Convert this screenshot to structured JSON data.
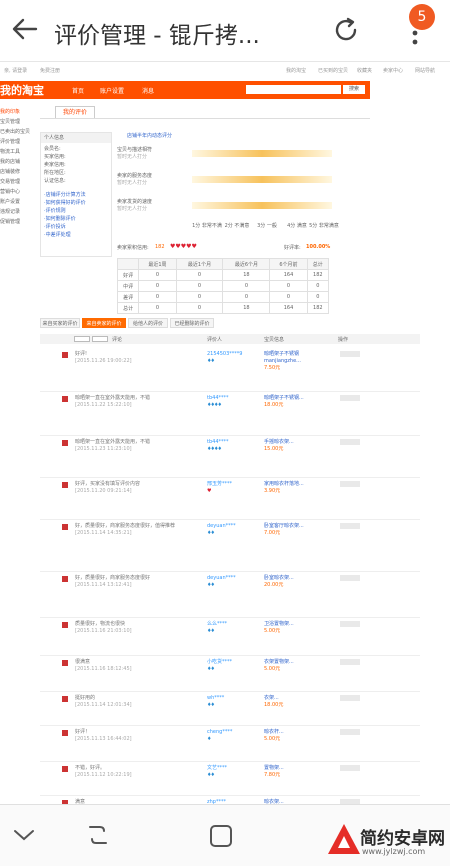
{
  "browser": {
    "title": "评价管理 - 锟斤拷...",
    "tab_count": "5"
  },
  "page": {
    "topstrip": [
      "亲, 请登录",
      "免费注册",
      "我的淘宝",
      "已买到的宝贝",
      "收藏夹",
      "卖家中心",
      "网站导航"
    ],
    "logo": "我的淘宝",
    "nav": [
      "首页",
      "账户设置",
      "消息"
    ],
    "search_button": "搜索",
    "left_menu": [
      "我的印象",
      "宝贝管理",
      "已卖出的宝贝",
      "评价管理",
      "物流工具",
      "我的店铺",
      "店铺装修",
      "交易管理",
      "营销中心",
      "账户设置",
      "违规记录",
      "促销管理"
    ],
    "tab_label": "我的评价",
    "panel": {
      "header": "个人信息",
      "lines": [
        "会员名: ",
        "买家信用:",
        "卖家信用:",
        "所在地区:",
        "认证信息:"
      ],
      "links": [
        "·店铺评分计算方法",
        "·如何获得好的评价",
        "·评价规则",
        "·如何删除评价",
        "·评价投诉",
        "·中差评处理"
      ]
    },
    "rating_title": "店铺半年内动态评分",
    "rating_rows": [
      {
        "label": "宝贝与描述相符",
        "sub": "暂时无人打分"
      },
      {
        "label": "卖家的服务态度",
        "sub": "暂时无人打分"
      },
      {
        "label": "卖家发货的速度",
        "sub": "暂时无人打分"
      }
    ],
    "scale": [
      "1分\n非常不满",
      "2分\n不满意",
      "3分\n一般",
      "4分\n满意",
      "5分\n非常满意"
    ],
    "credit_label": "卖家累积信用:",
    "credit_value": "182",
    "positive_label": "好评率:",
    "positive_value": "100.00%",
    "table": {
      "headers": [
        "",
        "最近1周",
        "最近1个月",
        "最近6个月",
        "6个月前",
        "总计"
      ],
      "rows": [
        [
          "好评",
          "0",
          "0",
          "18",
          "164",
          "182"
        ],
        [
          "中评",
          "0",
          "0",
          "0",
          "0",
          "0"
        ],
        [
          "差评",
          "0",
          "0",
          "0",
          "0",
          "0"
        ],
        [
          "总计",
          "0",
          "0",
          "18",
          "164",
          "182"
        ]
      ]
    },
    "tabs": [
      "来自买家的评价",
      "来自卖家的评价",
      "给他人的评价",
      "已经删除的评价"
    ],
    "filter": [
      "评论",
      "评价人",
      "宝贝信息",
      "操作"
    ]
  },
  "reviews": [
    {
      "text": "好评!",
      "time": "[2015.11.26 19:00:22]",
      "buyer": "2154503****9",
      "stars": "♦♦",
      "item": "晾晒架子不锈钢manjiangzhe...",
      "price": "7.50元"
    },
    {
      "text": "晾晒架一直在室外露天能用，不错",
      "time": "[2015.11.22 15:22:10]",
      "buyer": "tb44****",
      "stars": "♦♦♦♦",
      "item": "晾晒架子不锈钢...",
      "price": "18.00元"
    },
    {
      "text": "晾晒架一直在室外露天能用，不错",
      "time": "[2015.11.23 11:23:10]",
      "buyer": "tb44****",
      "stars": "♦♦♦♦",
      "item": "手摇晾衣架...",
      "price": "15.00元"
    },
    {
      "text": "好评，买家没有填写评价内容",
      "time": "[2015.11.20 09:21:14]",
      "buyer": "邢玉芳****",
      "stars": "♥",
      "item": "家用晾衣杆落地...",
      "price": "3.90元"
    },
    {
      "text": "好，质量很好，商家服务态度很好，值得推荐",
      "time": "[2015.11.14 14:35:21]",
      "buyer": "deyuan****",
      "stars": "♦♦",
      "item": "卧室客厅晾衣架...",
      "price": "7.00元"
    },
    {
      "text": "好，质量很好，商家服务态度很好",
      "time": "[2015.11.14 13:12:41]",
      "buyer": "deyuan****",
      "stars": "♦♦",
      "item": "卧室晾衣架...",
      "price": "20.00元"
    },
    {
      "text": "质量很好，物流也很快",
      "time": "[2015.11.16 21:03:10]",
      "buyer": "么么****",
      "stars": "♦♦",
      "item": "卫浴置物架...",
      "price": "5.00元"
    },
    {
      "text": "很满意",
      "time": "[2015.11.16 18:12:45]",
      "buyer": "小吃货****",
      "stars": "♦♦",
      "item": "衣架置物架...",
      "price": "5.00元"
    },
    {
      "text": "挺好用的",
      "time": "[2015.11.14 12:01:34]",
      "buyer": "wh****",
      "stars": "♦♦",
      "item": "衣架...",
      "price": "18.00元"
    },
    {
      "text": "好评！",
      "time": "[2015.11.13 16:44:02]",
      "buyer": "cheng****",
      "stars": "♦",
      "item": "晾衣杆...",
      "price": "5.00元"
    },
    {
      "text": "不错，好评。",
      "time": "[2015.11.12 10:22:19]",
      "buyer": "文艺****",
      "stars": "♦♦",
      "item": "置物架...",
      "price": "7.80元"
    },
    {
      "text": "满意",
      "time": "[2015.11.11 08:12:00]",
      "buyer": "zhp****",
      "stars": "♥♥♥♥",
      "item": "晾衣架...",
      "price": "8.00元"
    }
  ],
  "watermark": {
    "name": "简约安卓网",
    "url": "www.jylzwj.com"
  },
  "colors": {
    "brand": "#ff5000",
    "badge": "#f05a22"
  }
}
